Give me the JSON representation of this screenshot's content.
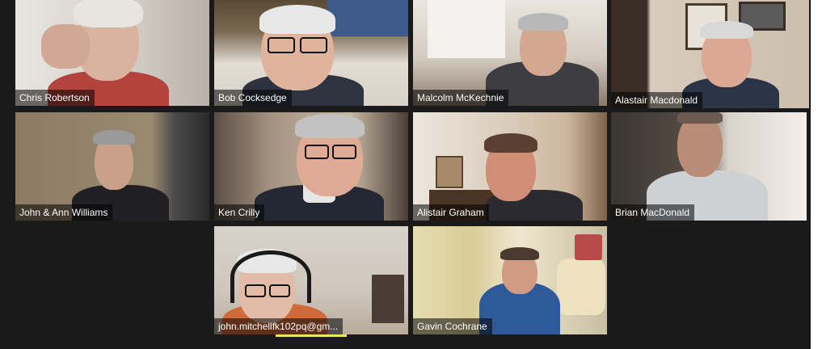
{
  "meeting": {
    "active_speaker_color": "#d6e06a",
    "participants": [
      {
        "name": "Chris Robertson",
        "bg": "#d9d4cf",
        "skin": "#d9b3a0",
        "shirt": "#b3433c",
        "hair": "#e8e4df"
      },
      {
        "name": "Bob Cocksedge",
        "bg": "#6b5a43",
        "skin": "#e0b39c",
        "shirt": "#2e3340",
        "hair": "#e8e8e8"
      },
      {
        "name": "Malcolm McKechnie",
        "bg": "#cfc6bb",
        "skin": "#d4a890",
        "shirt": "#3d3d42",
        "hair": "#b8b8b8"
      },
      {
        "name": "Alastair Macdonald",
        "bg": "#c8b7a3",
        "skin": "#dba893",
        "shirt": "#2b3447",
        "hair": "#d8d8d8"
      },
      {
        "name": "John & Ann Williams",
        "bg": "#7a6d5d",
        "skin": "#c9a08a",
        "shirt": "#1f1f24",
        "hair": "#9a9a9a"
      },
      {
        "name": "Ken Crilly",
        "bg": "#8f7f6f",
        "skin": "#e0ab94",
        "shirt": "#242833",
        "hair": "#c2c2c2"
      },
      {
        "name": "Alistair Graham",
        "bg": "#b99a7f",
        "skin": "#cf8e75",
        "shirt": "#2a2a30",
        "hair": "#5a4030"
      },
      {
        "name": "Brian MacDonald",
        "bg": "#3a3533",
        "skin": "#b88c76",
        "shirt": "#cfd0d4",
        "hair": "#6a5a50"
      },
      {
        "name": "john.mitchellfk102pq@gm...",
        "bg": "#c9c1b6",
        "skin": "#e2bca8",
        "shirt": "#d06a3a",
        "hair": "#e8e8e8"
      },
      {
        "name": "Gavin Cochrane",
        "bg": "#d8cfa8",
        "skin": "#d19a82",
        "shirt": "#2f5a9a",
        "hair": "#4a3a30"
      }
    ]
  }
}
